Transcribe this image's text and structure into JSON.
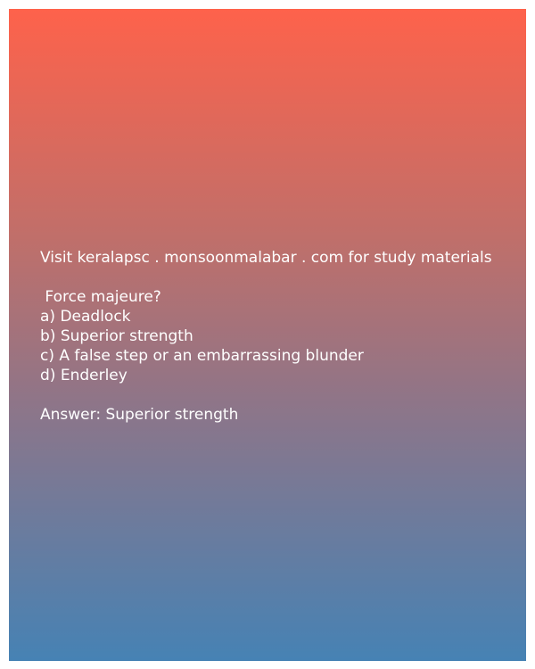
{
  "promo": "Visit keralapsc . monsoonmalabar . com for study materials",
  "question": " Force majeure?",
  "options": [
    "a) Deadlock",
    "b) Superior strength",
    "c) A false step or an embarrassing blunder",
    "d) Enderley"
  ],
  "answer": "Answer: Superior strength",
  "colors": {
    "gradient_top": "#fe624b",
    "gradient_bottom": "#4682b4",
    "text": "#ffffff"
  }
}
